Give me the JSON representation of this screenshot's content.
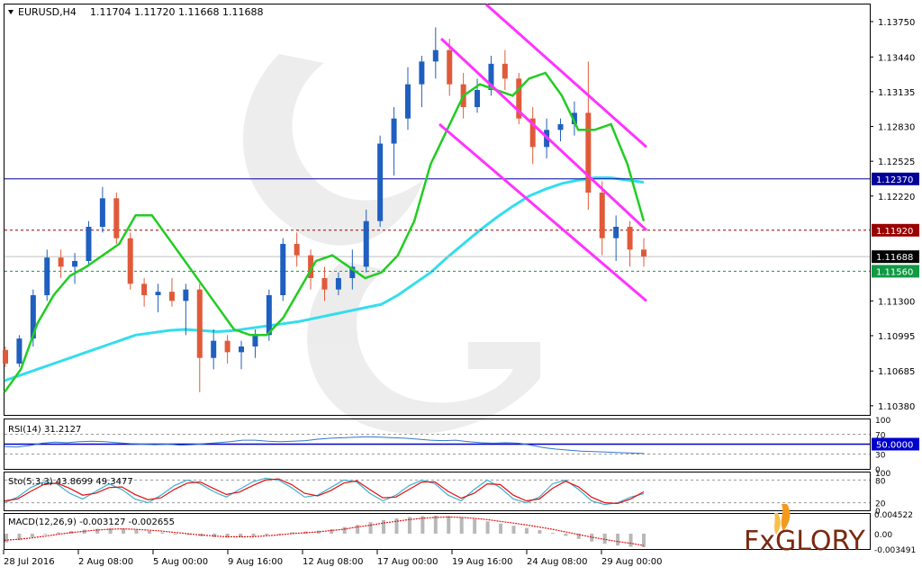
{
  "header": {
    "symbol": "EURUSD,H4",
    "ohlc": "1.11704 1.11720 1.11668 1.11688"
  },
  "colors": {
    "up_candle": "#1f5fbf",
    "down_candle": "#e05a3a",
    "ma_fast": "#22cc22",
    "ma_slow": "#33ddee",
    "channel": "#ff33ff",
    "resistance_line": "#000099",
    "dotted_resistance": "#990000",
    "dotted_support": "#119944",
    "rsi_line": "#3377cc",
    "stoch_main": "#3fb0d0",
    "stoch_signal": "#e01010",
    "macd_hist": "#b8b8b8",
    "macd_signal": "#e01010",
    "brand_orange": "#f39a1e",
    "brand_dark": "#7a2a10"
  },
  "chart_data": [
    {
      "type": "candlestick",
      "panel": "price",
      "x_ticks": [
        "28 Jul 2016",
        "2 Aug 08:00",
        "5 Aug 00:00",
        "9 Aug 16:00",
        "12 Aug 08:00",
        "17 Aug 00:00",
        "19 Aug 16:00",
        "24 Aug 08:00",
        "29 Aug 00:00"
      ],
      "y_ticks": [
        "1.13750",
        "1.13440",
        "1.13135",
        "1.12830",
        "1.12525",
        "1.12220",
        "1.11300",
        "1.10995",
        "1.10685",
        "1.10380"
      ],
      "ylim": [
        1.103,
        1.139
      ],
      "levels": [
        {
          "label": "1.12370",
          "value": 1.1237,
          "style": "solid"
        },
        {
          "label": "1.11920",
          "value": 1.1192,
          "style": "dotted"
        },
        {
          "label": "1.11688",
          "value": 1.11688,
          "style": "current"
        },
        {
          "label": "1.11560",
          "value": 1.1156,
          "style": "dotted"
        }
      ],
      "ma_fast": [
        1.105,
        1.107,
        1.111,
        1.1135,
        1.1152,
        1.116,
        1.117,
        1.118,
        1.1205,
        1.1205,
        1.1185,
        1.1165,
        1.1145,
        1.1125,
        1.1105,
        1.11,
        1.11,
        1.1115,
        1.114,
        1.1165,
        1.117,
        1.116,
        1.115,
        1.1155,
        1.117,
        1.12,
        1.125,
        1.128,
        1.131,
        1.132,
        1.1315,
        1.131,
        1.1325,
        1.133,
        1.131,
        1.128,
        1.128,
        1.1285,
        1.125,
        1.12
      ],
      "ma_slow": [
        1.106,
        1.1065,
        1.107,
        1.1075,
        1.108,
        1.1085,
        1.109,
        1.1095,
        1.11,
        1.1102,
        1.1104,
        1.1105,
        1.1104,
        1.1103,
        1.1104,
        1.1106,
        1.1108,
        1.111,
        1.1112,
        1.1115,
        1.1118,
        1.1121,
        1.1124,
        1.1127,
        1.1135,
        1.1145,
        1.1155,
        1.1168,
        1.118,
        1.1192,
        1.1203,
        1.1213,
        1.1222,
        1.1228,
        1.1233,
        1.1236,
        1.1238,
        1.1238,
        1.1236,
        1.1234
      ],
      "channel_upper": [
        [
          1.139,
          1.1265
        ]
      ],
      "channel_middle": [
        [
          1.136,
          1.1192
        ]
      ],
      "channel_lower": [
        [
          1.1285,
          1.113
        ]
      ],
      "candles": [
        [
          1.1087,
          1.109,
          1.1072,
          1.1075
        ],
        [
          1.1075,
          1.11,
          1.1072,
          1.1097
        ],
        [
          1.1097,
          1.114,
          1.109,
          1.1135
        ],
        [
          1.1135,
          1.1175,
          1.113,
          1.1168
        ],
        [
          1.1168,
          1.1175,
          1.115,
          1.116
        ],
        [
          1.116,
          1.1172,
          1.1145,
          1.1165
        ],
        [
          1.1165,
          1.12,
          1.116,
          1.1195
        ],
        [
          1.1195,
          1.123,
          1.119,
          1.122
        ],
        [
          1.122,
          1.1225,
          1.118,
          1.1185
        ],
        [
          1.1185,
          1.119,
          1.114,
          1.1145
        ],
        [
          1.1145,
          1.115,
          1.1125,
          1.1135
        ],
        [
          1.1135,
          1.1145,
          1.112,
          1.1138
        ],
        [
          1.1138,
          1.115,
          1.1125,
          1.113
        ],
        [
          1.113,
          1.1145,
          1.11,
          1.114
        ],
        [
          1.114,
          1.1145,
          1.105,
          1.108
        ],
        [
          1.108,
          1.1105,
          1.107,
          1.1095
        ],
        [
          1.1095,
          1.11,
          1.1075,
          1.1085
        ],
        [
          1.1085,
          1.1095,
          1.107,
          1.109
        ],
        [
          1.109,
          1.1105,
          1.108,
          1.11
        ],
        [
          1.11,
          1.114,
          1.1095,
          1.1135
        ],
        [
          1.1135,
          1.1185,
          1.113,
          1.118
        ],
        [
          1.118,
          1.119,
          1.116,
          1.117
        ],
        [
          1.117,
          1.1175,
          1.114,
          1.115
        ],
        [
          1.115,
          1.116,
          1.113,
          1.114
        ],
        [
          1.114,
          1.1155,
          1.1135,
          1.115
        ],
        [
          1.115,
          1.1175,
          1.114,
          1.116
        ],
        [
          1.116,
          1.121,
          1.1155,
          1.12
        ],
        [
          1.12,
          1.1275,
          1.1195,
          1.1268
        ],
        [
          1.1268,
          1.13,
          1.124,
          1.129
        ],
        [
          1.129,
          1.1335,
          1.128,
          1.132
        ],
        [
          1.132,
          1.1345,
          1.13,
          1.134
        ],
        [
          1.134,
          1.137,
          1.1325,
          1.135
        ],
        [
          1.135,
          1.136,
          1.131,
          1.132
        ],
        [
          1.132,
          1.133,
          1.129,
          1.13
        ],
        [
          1.13,
          1.1325,
          1.1295,
          1.1315
        ],
        [
          1.1315,
          1.1345,
          1.131,
          1.1338
        ],
        [
          1.1338,
          1.135,
          1.1315,
          1.1325
        ],
        [
          1.1325,
          1.133,
          1.1285,
          1.129
        ],
        [
          1.129,
          1.13,
          1.125,
          1.1265
        ],
        [
          1.1265,
          1.129,
          1.1255,
          1.128
        ],
        [
          1.128,
          1.129,
          1.127,
          1.1285
        ],
        [
          1.1285,
          1.1305,
          1.1275,
          1.1295
        ],
        [
          1.1295,
          1.134,
          1.121,
          1.1225
        ],
        [
          1.1225,
          1.1235,
          1.117,
          1.1185
        ],
        [
          1.1185,
          1.1205,
          1.1165,
          1.1195
        ],
        [
          1.1195,
          1.12,
          1.116,
          1.1175
        ],
        [
          1.1175,
          1.1185,
          1.116,
          1.1169
        ]
      ]
    },
    {
      "type": "line",
      "panel": "rsi",
      "label": "RSI(14) 31.2127",
      "level_label": "50.0000",
      "y_ticks": [
        "100",
        "70",
        "30",
        "0"
      ],
      "ylim": [
        0,
        100
      ],
      "values": [
        45,
        44,
        47,
        52,
        54,
        53,
        55,
        56,
        55,
        53,
        51,
        50,
        49,
        50,
        48,
        49,
        51,
        53,
        55,
        58,
        58,
        56,
        55,
        56,
        57,
        60,
        62,
        63,
        64,
        65,
        64,
        63,
        62,
        60,
        58,
        57,
        58,
        55,
        53,
        52,
        53,
        52,
        48,
        43,
        40,
        38,
        36,
        35,
        34,
        33,
        32,
        31
      ]
    },
    {
      "type": "line",
      "panel": "stochastic",
      "label": "Sto(5,3,3) 43.8699 49.3477",
      "y_ticks": [
        "100",
        "80",
        "20",
        "0"
      ],
      "ylim": [
        0,
        100
      ],
      "main": [
        20,
        35,
        60,
        75,
        70,
        45,
        30,
        50,
        70,
        55,
        30,
        20,
        40,
        65,
        80,
        70,
        50,
        35,
        55,
        75,
        85,
        80,
        60,
        35,
        40,
        60,
        80,
        75,
        45,
        25,
        40,
        65,
        80,
        70,
        40,
        25,
        55,
        80,
        60,
        30,
        20,
        35,
        70,
        80,
        55,
        25,
        15,
        20,
        35,
        44
      ],
      "signal": [
        25,
        30,
        50,
        68,
        72,
        58,
        40,
        45,
        60,
        62,
        42,
        28,
        33,
        55,
        72,
        75,
        58,
        42,
        48,
        65,
        80,
        83,
        68,
        45,
        38,
        52,
        72,
        78,
        55,
        33,
        35,
        55,
        75,
        75,
        50,
        32,
        45,
        70,
        68,
        40,
        25,
        30,
        58,
        77,
        62,
        35,
        20,
        18,
        30,
        49
      ]
    },
    {
      "type": "bar",
      "panel": "macd",
      "label": "MACD(12,26,9) -0.003127 -0.002655",
      "y_ticks": [
        "0.004522",
        "0.00",
        "-0.003491"
      ],
      "ylim": [
        -0.0035,
        0.0045
      ],
      "histogram": [
        -0.002,
        -0.0015,
        -0.0008,
        -0.0002,
        0.0003,
        0.0006,
        0.0009,
        0.0011,
        0.0012,
        0.0011,
        0.0009,
        0.0006,
        0.0003,
        0.0,
        -0.0003,
        -0.0006,
        -0.0008,
        -0.0009,
        -0.0008,
        -0.0006,
        -0.0003,
        0.0,
        0.0003,
        0.0005,
        0.0007,
        0.001,
        0.0015,
        0.002,
        0.0026,
        0.0031,
        0.0035,
        0.0038,
        0.004,
        0.0041,
        0.004,
        0.0037,
        0.0033,
        0.0028,
        0.0023,
        0.0018,
        0.0013,
        0.0008,
        0.0002,
        -0.0005,
        -0.0012,
        -0.0018,
        -0.0023,
        -0.0027,
        -0.003,
        -0.0031
      ],
      "signal": [
        -0.0015,
        -0.0013,
        -0.001,
        -0.0006,
        -0.0002,
        0.0002,
        0.0005,
        0.0008,
        0.001,
        0.0011,
        0.001,
        0.0008,
        0.0006,
        0.0003,
        0.0,
        -0.0003,
        -0.0005,
        -0.0007,
        -0.0007,
        -0.0007,
        -0.0005,
        -0.0003,
        0.0,
        0.0002,
        0.0004,
        0.0007,
        0.001,
        0.0015,
        0.0019,
        0.0024,
        0.0028,
        0.0032,
        0.0035,
        0.0037,
        0.0038,
        0.0037,
        0.0035,
        0.0032,
        0.0028,
        0.0024,
        0.002,
        0.0015,
        0.001,
        0.0004,
        -0.0002,
        -0.0008,
        -0.0013,
        -0.0018,
        -0.0022,
        -0.0027
      ]
    }
  ],
  "branding": {
    "logo_text": "FxGLORY"
  }
}
